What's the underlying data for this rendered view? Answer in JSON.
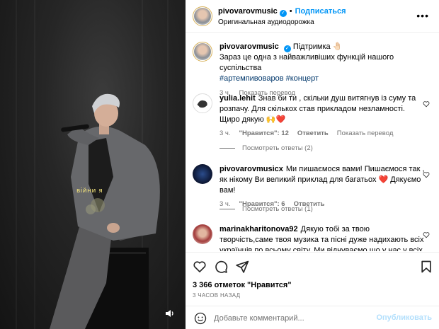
{
  "media": {
    "caption_text": "війни я",
    "audio_icon": "speaker-icon"
  },
  "header": {
    "username": "pivovarovmusic",
    "follow_label": "Подписаться",
    "separator": "•",
    "subtitle": "Оригинальная аудиодорожка",
    "more_icon": "more-horizontal-icon"
  },
  "caption": {
    "username": "pivovarovmusic",
    "text_line1": "Підтримка 🤚🏻",
    "text_line2": "Зараз це одна з найважливіших функцій нашого суспільства",
    "hashtag1": "#артемпивоваров",
    "hashtag2": "#концерт",
    "time": "3 ч.",
    "translate": "Показать перевод"
  },
  "comments": [
    {
      "username": "yulia.lehit",
      "text": "Знав би ти , скільки душ витягнув із суму та розпачу. Для скількох став прикладом незламності. Щиро дякую 🙌❤️",
      "time": "3 ч.",
      "likes": "\"Нравится\": 12",
      "reply": "Ответить",
      "translate": "Показать перевод",
      "view_replies": "Посмотреть ответы (2)"
    },
    {
      "username": "pivovarovmusicx",
      "text": "Ми пишаємося вами! Пишаємося так , як нікому Ви великий приклад для багатьох ❤️ Дякуємо вам!",
      "time": "3 ч.",
      "likes": "\"Нравится\": 6",
      "reply": "Ответить",
      "view_replies": "Посмотреть ответы (1)"
    },
    {
      "username": "marinakharitonova92",
      "text": "Дякую тобі за твою творчість,саме твоя музика та пісні дуже надихають всіх українців по всьому світу. Ми відчуваємо,що у нас у всіх одне на всіх"
    }
  ],
  "actions": {
    "likes": "3 366 отметок \"Нравится\"",
    "time": "3 ЧАСОВ НАЗАД",
    "comment_placeholder": "Добавьте комментарий...",
    "publish_label": "Опубликовать"
  },
  "colors": {
    "accent": "#0095f6",
    "muted": "#737373",
    "hashtag": "#00376b",
    "heart": "#ed4956"
  }
}
